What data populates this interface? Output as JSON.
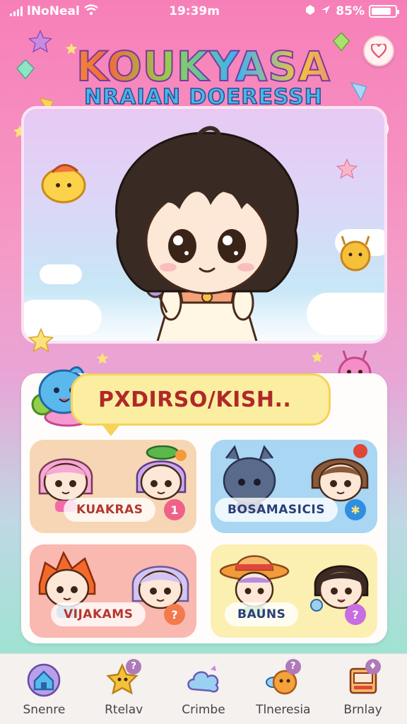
{
  "status_bar": {
    "carrier": "lNoNeal",
    "time": "19:39m",
    "battery_percent": "85%",
    "battery_level": 0.85
  },
  "header": {
    "title": "KOUKYASA",
    "subtitle": "NRAIAN DOERESSH",
    "favorite_icon": "heart-icon"
  },
  "speech": {
    "text": "PXDIRSO/KISH.."
  },
  "tiles": [
    {
      "label": "KUAKRAS",
      "badge": "1",
      "color": "#f6d6b4",
      "badge_color": "#f0618a"
    },
    {
      "label": "BOSAMASICIS",
      "badge": "✱",
      "color": "#a8d6f3",
      "badge_color": "#2f8ee0"
    },
    {
      "label": "VIJAKAMS",
      "badge": "?",
      "color": "#f9b8b0",
      "badge_color": "#f27a4d"
    },
    {
      "label": "BAUNS",
      "badge": "?",
      "color": "#fcefb2",
      "badge_color": "#c86ee0"
    }
  ],
  "tab_bar": {
    "items": [
      {
        "label": "Snenre",
        "icon": "home-icon",
        "badge": ""
      },
      {
        "label": "Rtelav",
        "icon": "star-character-icon",
        "badge": "?"
      },
      {
        "label": "Crimbe",
        "icon": "cloud-icon",
        "badge": ""
      },
      {
        "label": "Tlneresia",
        "icon": "bee-character-icon",
        "badge": "?"
      },
      {
        "label": "Brnlay",
        "icon": "store-icon",
        "badge": "♦"
      }
    ]
  },
  "colors": {
    "accent_pink": "#f77fb8",
    "bubble_yellow": "#fbeea0",
    "bubble_text": "#b0282a"
  }
}
